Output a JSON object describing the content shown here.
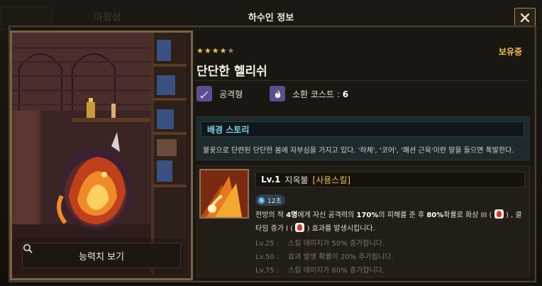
{
  "background": {
    "ghost_title": "마왕성"
  },
  "modal": {
    "title": "하수인 정보"
  },
  "hero": {
    "stars_filled": 4,
    "stars_total": 5,
    "owned_label": "보유중",
    "name": "단단한 헬리쉬",
    "type_label": "공격형",
    "cost_label": "소환 코스트 :",
    "cost_value": "6"
  },
  "portrait": {
    "stat_button_label": "능력치 보기"
  },
  "story": {
    "heading": "배경 스토리",
    "text": "불꽃으로 단련된 단단한 몸에 자부심을 가지고 있다. '하체', '코어', '패션 근육'이란 말을 들으면 폭발한다."
  },
  "skill": {
    "level": "Lv.1",
    "name": "지옥불",
    "tag": "[사용스킬]",
    "cooldown": "12초",
    "desc_a": "전방의 적",
    "desc_targets": "4명",
    "desc_b": "에게 자신 공격력의",
    "desc_dmg": "170%",
    "desc_c": "의 피해를 준 후",
    "desc_chance": "80%",
    "desc_d": "확률로 화상 III (",
    "desc_e": ") , 쿨",
    "desc_f": "타임 증가 I (",
    "desc_g": ") 효과를 발생시킵니다.",
    "upgrades": [
      {
        "level": "Lv.25 :",
        "text": "스킬 데미지가 50% 증가합니다."
      },
      {
        "level": "Lv.50 :",
        "text": "효과 발생 확률이 20% 추가됩니다."
      },
      {
        "level": "Lv.75 :",
        "text": "스킬 데미지가 60% 증가합니다."
      }
    ]
  },
  "colors": {
    "accent_gold": "#f2c347",
    "story_blue": "#7fd0e6",
    "type_purple": "#5a4f8e"
  }
}
